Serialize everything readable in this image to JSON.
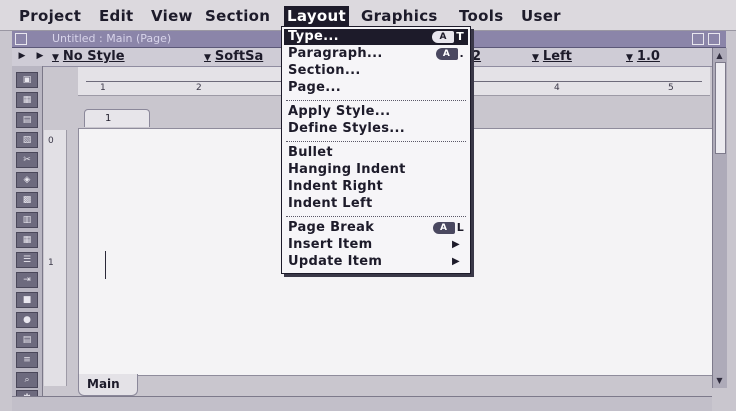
{
  "menubar": {
    "items": [
      "Project",
      "Edit",
      "View",
      "Section",
      "Layout",
      "Graphics",
      "Tools",
      "User"
    ],
    "active": "Layout"
  },
  "window": {
    "title": "Untitled : Main (Page)"
  },
  "stylebar": {
    "style": "No Style",
    "font": "SoftSa",
    "size": "2",
    "align": "Left",
    "spacing": "1.0"
  },
  "ruler": {
    "numbers": [
      "1",
      "2",
      "4",
      "5"
    ]
  },
  "leftruler": {
    "numbers": [
      "0",
      "1"
    ]
  },
  "tab_top": {
    "label": "1"
  },
  "bottom_tab": {
    "label": "Main"
  },
  "dropdown": {
    "items": [
      {
        "label": "Type...",
        "shortcut_key": "T",
        "selected": true
      },
      {
        "label": "Paragraph...",
        "shortcut_key": "."
      },
      {
        "label": "Section..."
      },
      {
        "label": "Page..."
      },
      {
        "label": "Apply Style..."
      },
      {
        "label": "Define Styles..."
      },
      {
        "label": "Bullet"
      },
      {
        "label": "Hanging Indent"
      },
      {
        "label": "Indent Right"
      },
      {
        "label": "Indent Left"
      },
      {
        "label": "Page Break",
        "shortcut_key": "L"
      },
      {
        "label": "Insert Item",
        "submenu": true
      },
      {
        "label": "Update Item",
        "submenu": true
      }
    ],
    "cmd_glyph": "A"
  },
  "colors": {
    "menubar": "#dcd9de",
    "selection": "#1d1b2a",
    "titlebar": "#8b85a9",
    "document": "#f4f3f5"
  }
}
